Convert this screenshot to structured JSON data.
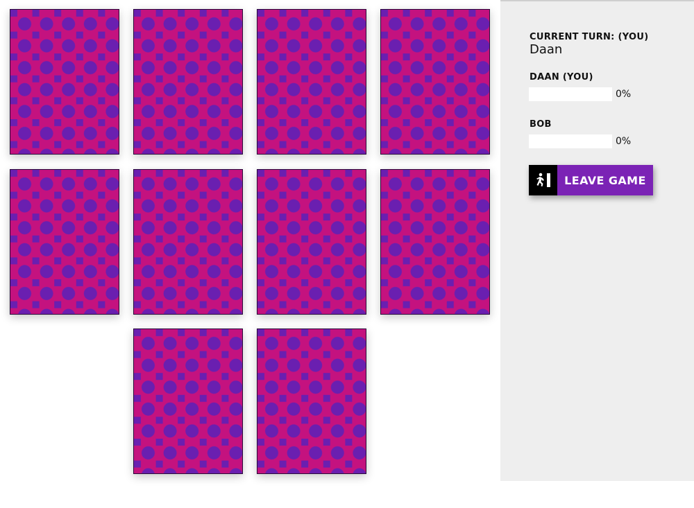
{
  "game": {
    "card_count": 10,
    "card_back_colors": {
      "base": "#c4127f",
      "pattern": "#6a1fb0"
    }
  },
  "sidebar": {
    "current_turn_label": "CURRENT TURN: (YOU)",
    "current_turn_player": "Daan",
    "players": [
      {
        "label": "DAAN (YOU)",
        "progress": 0,
        "progress_text": "0%"
      },
      {
        "label": "BOB",
        "progress": 0,
        "progress_text": "0%"
      }
    ],
    "leave_button": {
      "label": "LEAVE GAME",
      "icon": "exit-door-icon",
      "color": "#7b23b5"
    }
  }
}
